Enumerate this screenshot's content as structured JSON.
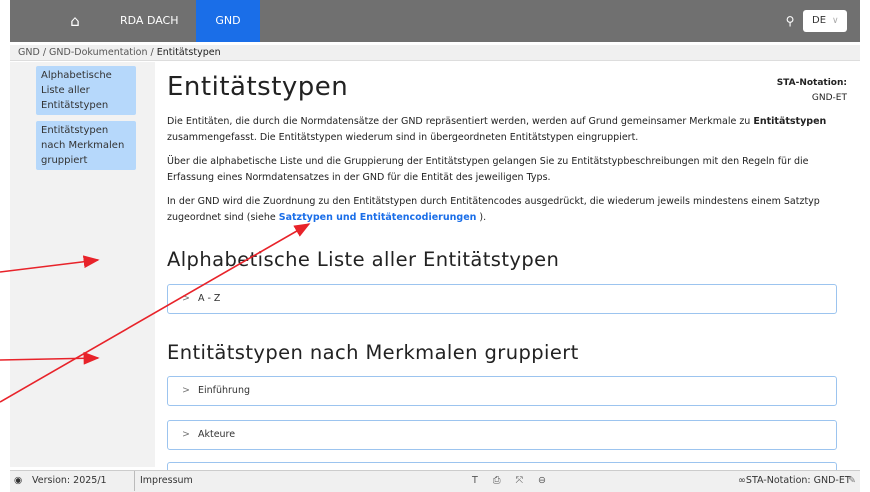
{
  "header": {
    "home_icon": "home-icon",
    "nav_rda": "RDA DACH",
    "nav_gnd": "GND",
    "search_icon": "search-icon",
    "language": "DE",
    "accent_color": "#1a6ee8"
  },
  "breadcrumb": {
    "item1": "GND",
    "sep1": " / ",
    "item2": "GND-Dokumentation",
    "sep2": " / ",
    "current": "Entitätstypen"
  },
  "sidebar": {
    "items": [
      {
        "label": "Alphabetische Liste aller Entitätstypen"
      },
      {
        "label": "Entitätstypen nach Merkmalen gruppiert"
      }
    ]
  },
  "main": {
    "title": "Entitätstypen",
    "sta_label": "STA-Notation:",
    "sta_value": "GND-ET",
    "para1_a": "Die Entitäten, die durch die Normdatensätze der GND repräsentiert werden, werden auf Grund gemeinsamer Merkmale zu ",
    "para1_bold": "Entitätstypen",
    "para1_b": " zusammengefasst. Die Entitätstypen wiederum sind in übergeordneten Entitätstypen eingruppiert.",
    "para2": "Über die alphabetische Liste und die Gruppierung der Entitätstypen gelangen Sie zu Entitätstypbeschreibungen mit den Regeln für die Erfassung eines Normdatensatzes in der GND für die Entität des jeweiligen Typs.",
    "para3_a": "In der GND wird die Zuordnung zu den Entitätstypen durch Entitätencodes ausgedrückt, die wiederum jeweils mindestens einem Satztyp zugeordnet sind (siehe ",
    "para3_link": "Satztypen und Entitätencodierungen",
    "para3_b": " ).",
    "section1_title": "Alphabetische Liste aller Entitätstypen",
    "section1_items": [
      "A - Z"
    ],
    "section2_title": "Entitätstypen nach Merkmalen gruppiert",
    "section2_items": [
      "Einführung",
      "Akteure"
    ]
  },
  "footer": {
    "github_icon": "github-icon",
    "version": "Version: 2025/1",
    "impressum": "Impressum",
    "tools": "T ⎙ ⤧ ⊖",
    "sta_notation": "STA-Notation: GND-ET",
    "edit_icon": "pencil-icon"
  },
  "annotation_color": "#e8232a"
}
